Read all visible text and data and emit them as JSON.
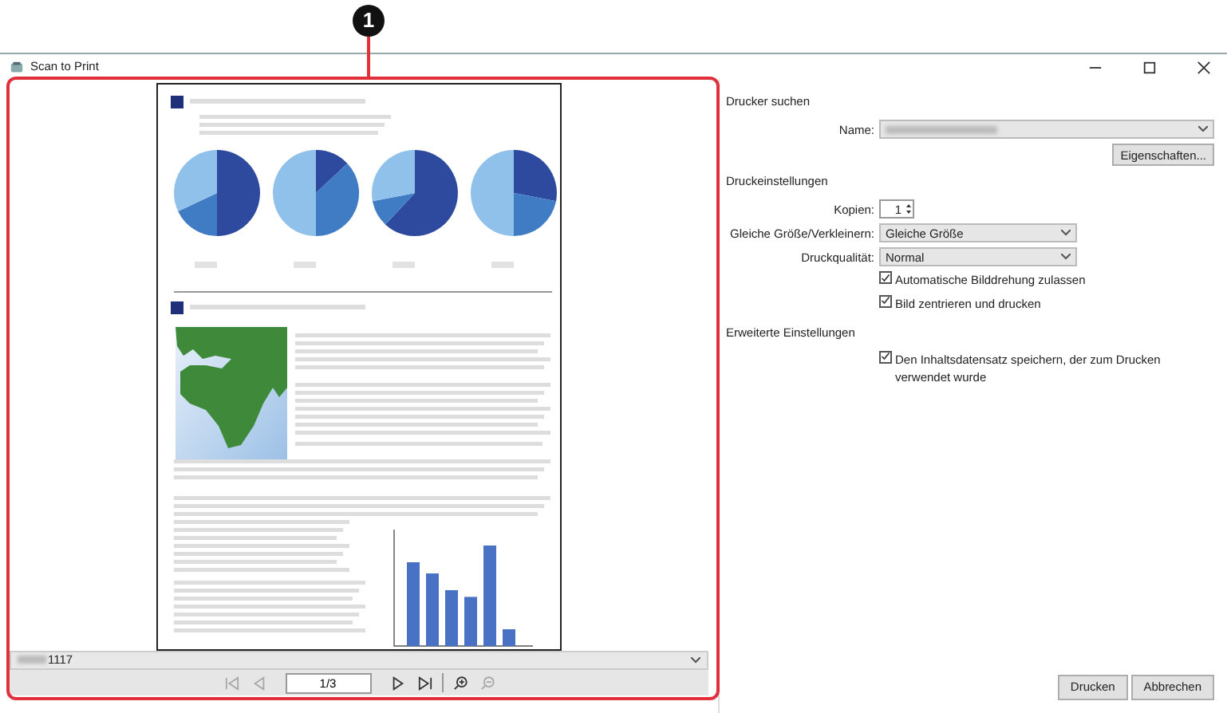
{
  "callout": {
    "label": "1"
  },
  "window": {
    "title": "Scan to Print"
  },
  "preview": {
    "file_label": "1117",
    "page_field": "1/3",
    "nav_buttons": [
      {
        "kind": "first",
        "disabled": true
      },
      {
        "kind": "prev",
        "disabled": true
      },
      {
        "kind": "next",
        "disabled": false
      },
      {
        "kind": "last",
        "disabled": false
      },
      {
        "kind": "zoom_in",
        "disabled": false
      },
      {
        "kind": "zoom_out",
        "disabled": true
      }
    ]
  },
  "printer": {
    "section": "Drucker suchen",
    "name_label": "Name:",
    "properties_button": "Eigenschaften..."
  },
  "settings": {
    "section": "Druckeinstellungen",
    "copies_label": "Kopien:",
    "copies_value": "1",
    "size_label": "Gleiche Größe/Verkleinern:",
    "size_value": "Gleiche Größe",
    "quality_label": "Druckqualität:",
    "quality_value": "Normal",
    "options": [
      {
        "label": "Automatische Bilddrehung zulassen",
        "checked": true
      },
      {
        "label": "Bild zentrieren und drucken",
        "checked": true
      }
    ]
  },
  "advanced": {
    "section": "Erweiterte Einstellungen",
    "options": [
      {
        "label": "Den Inhaltsdatensatz speichern, der zum Drucken verwendet wurde",
        "checked": true
      }
    ]
  },
  "buttons": [
    "Drucken",
    "Abbrechen"
  ]
}
